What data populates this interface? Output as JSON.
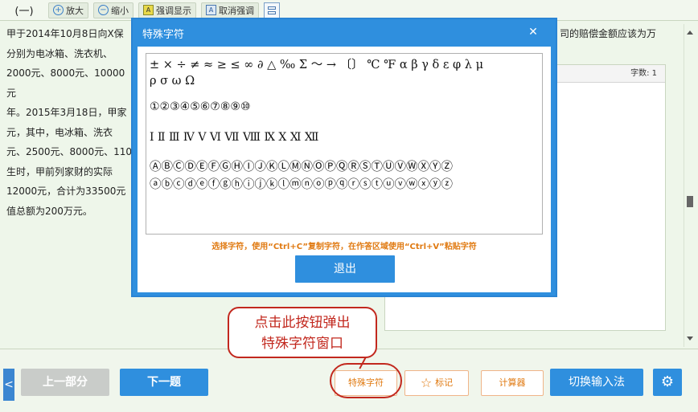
{
  "toolbar": {
    "section_label": "(一)",
    "zoom_in_icon": "+",
    "zoom_in_label": "放大",
    "zoom_out_icon": "−",
    "zoom_out_label": "缩小",
    "highlight_icon": "A",
    "highlight_label": "强调显示",
    "cancel_highlight_icon": "A",
    "cancel_highlight_label": "取消强调"
  },
  "question": {
    "lines": [
      "甲于2014年10月8日向X保",
      "分别为电冰箱、洗衣机、",
      "2000元、8000元、10000元",
      "年。2015年3月18日，甲家",
      "元，其中，电冰箱、洗衣",
      "元、2500元、8000元、110",
      "生时，甲前列家财的实际",
      "12000元，合计为33500元",
      "值总额为200万元。"
    ],
    "right_lines": [
      "司的赔偿金额应该为万"
    ]
  },
  "answer": {
    "word_count": "字数: 1"
  },
  "modal": {
    "title": "特殊字符",
    "close_icon": "✕",
    "rows": [
      "± × ÷ ≠  ≈  ≥  ≤  ∞  ∂  △  ‰  Σ 〜  →  〔〕  ℃  ℉  α β γ δ ε φ λ μ",
      "ρ σ ω Ω",
      "①②③④⑤⑥⑦⑧⑨⑩",
      "Ⅰ  Ⅱ  Ⅲ  Ⅳ  Ⅴ  Ⅵ  Ⅶ  Ⅷ  Ⅸ  Ⅹ  Ⅺ  Ⅻ",
      "ⒶⒷⒸⒹⒺⒻⒼⒽⒾⒿⓀⓁⓂⓃⓄⓅⓆⓇⓈⓉⓊⓋⓌⓍⓎⓏ",
      "ⓐⓑⓒⓓⓔⓕⓖⓗⓘⓙⓚⓛⓜⓝⓞⓟⓠⓡⓢⓣⓤⓥⓦⓧⓨⓩ"
    ],
    "hint": "选择字符，使用“Ctrl+C”复制字符，在作答区域使用“Ctrl+V”粘贴字符",
    "exit_label": "退出"
  },
  "callout": {
    "line1": "点击此按钮弹出",
    "line2": "特殊字符窗口"
  },
  "bottom": {
    "collapse_icon": "<",
    "prev_label": "上一部分",
    "next_label": "下一题",
    "special_label": "特殊字符",
    "mark_icon": "☆",
    "mark_label": "标记",
    "calc_label": "计算器",
    "switch_label": "切换输入法",
    "gear_icon": "⚙"
  },
  "colors": {
    "primary_blue": "#2f8fde",
    "accent_orange": "#e07a12",
    "callout_red": "#c2281e",
    "background_green": "#eef6ea"
  }
}
